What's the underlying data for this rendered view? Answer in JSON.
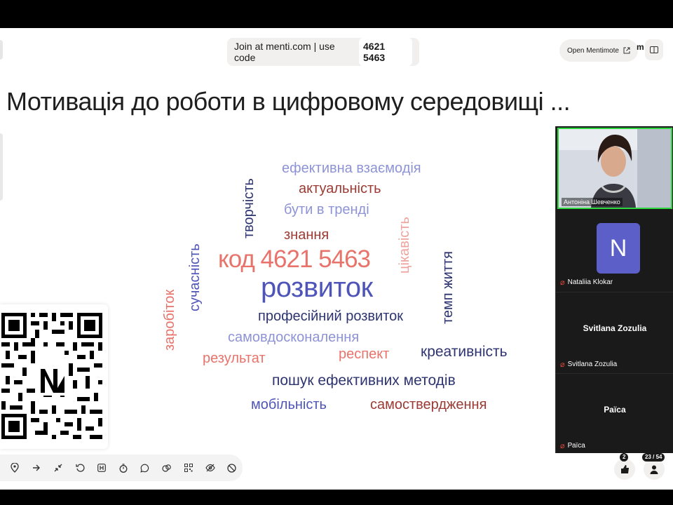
{
  "join": {
    "prefix": "Join at menti.com | use code",
    "code": "4621 5463"
  },
  "mentimote": {
    "label": "Open Mentimote",
    "brand_fragment": "m"
  },
  "slide_title": "Мотивація до роботи в цифровому середовищі ...",
  "word_cloud": {
    "words": [
      {
        "text": "ефективна взаємодія",
        "color": "#8e93d6"
      },
      {
        "text": "актуальність",
        "color": "#9b3a33"
      },
      {
        "text": "бути в тренді",
        "color": "#8e93d6"
      },
      {
        "text": "знання",
        "color": "#9b3a33"
      },
      {
        "text": "код 4621 5463",
        "color": "#e8736b"
      },
      {
        "text": "розвиток",
        "color": "#4f55b8"
      },
      {
        "text": "професійний розвиток",
        "color": "#2e3470"
      },
      {
        "text": "самовдосконалення",
        "color": "#8e93d6"
      },
      {
        "text": "результат",
        "color": "#e8736b"
      },
      {
        "text": "респект",
        "color": "#e8736b"
      },
      {
        "text": "креативність",
        "color": "#2e3470"
      },
      {
        "text": "пошук ефективних методів",
        "color": "#2e3470"
      },
      {
        "text": "мобільність",
        "color": "#4f55b8"
      },
      {
        "text": "самоствердження",
        "color": "#9b3a33"
      },
      {
        "text": "творчість",
        "color": "#2e3470"
      },
      {
        "text": "сучасність",
        "color": "#4f55b8"
      },
      {
        "text": "заробіток",
        "color": "#e8736b"
      },
      {
        "text": "цікавість",
        "color": "#f0a39d"
      },
      {
        "text": "темп життя",
        "color": "#2e3470"
      }
    ]
  },
  "toolbar": {
    "buttons": [
      "marker-icon",
      "next-icon",
      "collapse-icon",
      "reset-icon",
      "hotkeys-icon",
      "timer-icon",
      "comments-icon",
      "reactions-icon",
      "qr-icon",
      "hide-results-icon",
      "close-voting-icon"
    ]
  },
  "reactions": {
    "like_count": "2",
    "participants": "23 / 54"
  },
  "participants": {
    "active_speaker": "Антоніна Шевченко",
    "tiles": [
      {
        "avatar_letter": "N",
        "name": "Nataliia Klokar"
      },
      {
        "center_name": "Svitlana Zozulia",
        "name": "Svitlana Zozulia"
      },
      {
        "center_name": "Раїса",
        "name": "Раїса"
      }
    ]
  },
  "colors": {
    "green_active": "#2bd63e",
    "zoom_avatar": "#5b5fc7",
    "mic_off": "#e0463b"
  }
}
